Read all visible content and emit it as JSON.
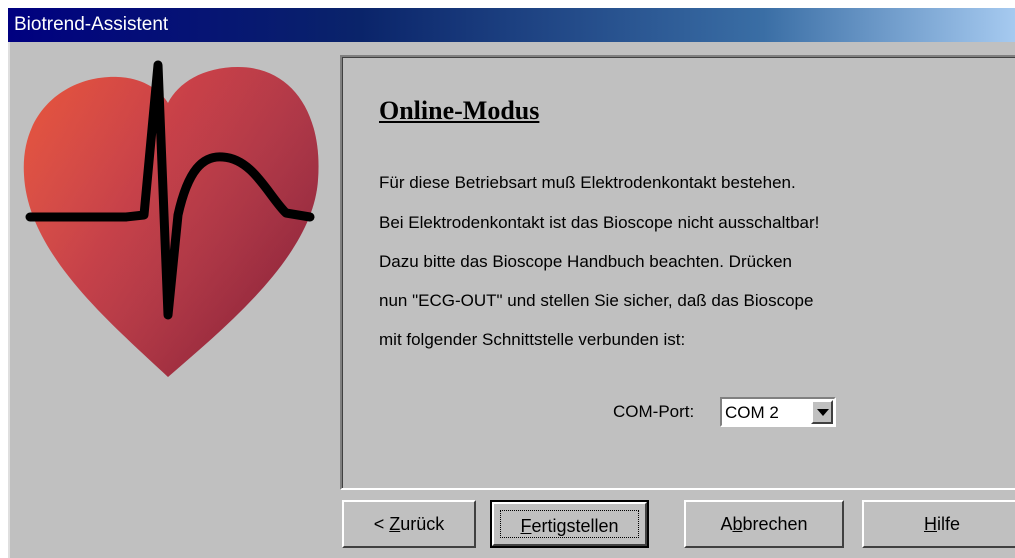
{
  "window": {
    "title": "Biotrend-Assistent"
  },
  "content": {
    "heading": "Online-Modus",
    "lines": [
      "Für diese Betriebsart muß Elektrodenkontakt bestehen.",
      "Bei Elektrodenkontakt ist das Bioscope nicht ausschaltbar!",
      "Dazu bitte das Bioscope Handbuch beachten. Drücken",
      "nun \"ECG-OUT\" und stellen Sie sicher, daß das Bioscope",
      "mit folgender Schnittstelle verbunden ist:"
    ],
    "com_port": {
      "label": "COM-Port:",
      "value": "COM 2"
    }
  },
  "buttons": {
    "back": {
      "prefix": "< ",
      "mnemonic": "Z",
      "rest": "urück"
    },
    "finish": {
      "mnemonic": "F",
      "rest": "ertigstellen"
    },
    "cancel": {
      "pre": "A",
      "mnemonic": "b",
      "rest": "brechen"
    },
    "help": {
      "mnemonic": "H",
      "rest": "ilfe"
    }
  },
  "colors": {
    "titlebar_start": "#000080",
    "titlebar_end": "#a6caf0",
    "dialog_face": "#c0c0c0",
    "heart_light": "#e0482e",
    "heart_dark": "#a3243a"
  },
  "icons": {
    "heart_illustration": "heart-ecg-icon",
    "dropdown": "chevron-down-icon"
  }
}
